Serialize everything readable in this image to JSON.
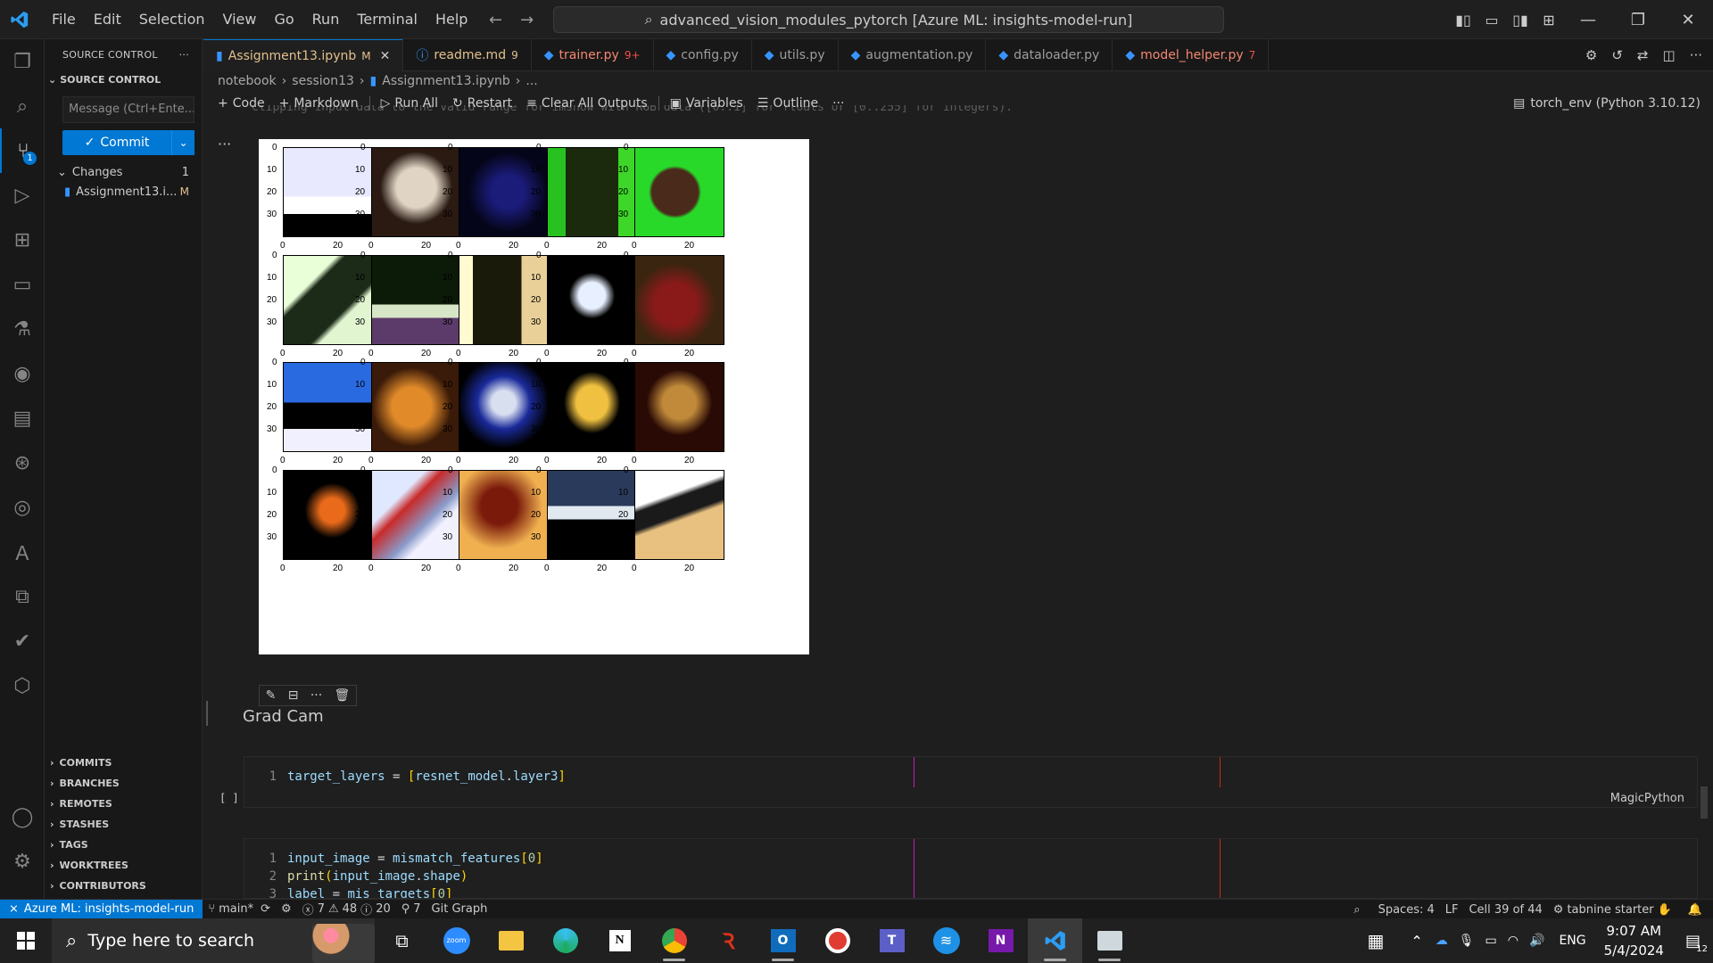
{
  "window": {
    "title": "advanced_vision_modules_pytorch [Azure ML: insights-model-run]"
  },
  "menu": [
    "File",
    "Edit",
    "Selection",
    "View",
    "Go",
    "Run",
    "Terminal",
    "Help"
  ],
  "sidebar": {
    "header": "SOURCE CONTROL",
    "subheader": "SOURCE CONTROL",
    "message_placeholder": "Message (Ctrl+Ente...",
    "commit_label": "Commit",
    "changes_label": "Changes",
    "changes_count": "1",
    "file_name": "Assignment13.i...",
    "file_status": "M",
    "sections": [
      "COMMITS",
      "BRANCHES",
      "REMOTES",
      "STASHES",
      "TAGS",
      "WORKTREES",
      "CONTRIBUTORS"
    ],
    "scm_badge": "1"
  },
  "tabs": [
    {
      "name": "Assignment13.ipynb",
      "decoration": "M",
      "active": true
    },
    {
      "name": "readme.md",
      "decoration": "9"
    },
    {
      "name": "trainer.py",
      "decoration": "9+"
    },
    {
      "name": "config.py",
      "decoration": ""
    },
    {
      "name": "utils.py",
      "decoration": ""
    },
    {
      "name": "augmentation.py",
      "decoration": ""
    },
    {
      "name": "dataloader.py",
      "decoration": ""
    },
    {
      "name": "model_helper.py",
      "decoration": "7"
    }
  ],
  "breadcrumb": [
    "notebook",
    "session13",
    "Assignment13.ipynb",
    "..."
  ],
  "toolbar": {
    "code": "Code",
    "markdown": "Markdown",
    "run_all": "Run All",
    "restart": "Restart",
    "clear": "Clear All Outputs",
    "variables": "Variables",
    "outline": "Outline",
    "more": "···",
    "kernel": "torch_env (Python 3.10.12)"
  },
  "output": {
    "overflow_line": "Clipping input data to the valid range for imshow with RGB data ([0..1] for floats or [0..255] for integers).",
    "x_ticks": [
      "0",
      "20"
    ],
    "y_ticks": [
      "0",
      "10",
      "20",
      "30"
    ]
  },
  "markdown_cell": {
    "text": "Grad Cam"
  },
  "code_cells": [
    {
      "exec": "[ ]",
      "language": "MagicPython",
      "lines": [
        {
          "n": "1",
          "parts": [
            "target_layers",
            " = ",
            "[",
            "resnet_model",
            ".",
            "layer3",
            "]"
          ]
        }
      ]
    },
    {
      "lines": [
        {
          "n": "1",
          "parts": [
            "input_image",
            " = ",
            "mismatch_features",
            "[",
            "0",
            "]"
          ]
        },
        {
          "n": "2",
          "parts": [
            "print",
            "(",
            "input_image",
            ".",
            "shape",
            ")"
          ]
        },
        {
          "n": "3",
          "parts": [
            "label",
            " = ",
            "mis_targets",
            "[",
            "0",
            "]"
          ]
        }
      ]
    }
  ],
  "statusbar": {
    "remote": "Azure ML: insights-model-run",
    "branch": "main*",
    "errors": "7",
    "warnings": "48",
    "infos": "20",
    "ports": "7",
    "git_graph": "Git Graph",
    "spaces": "Spaces: 4",
    "eol": "LF",
    "cell": "Cell 39 of 44",
    "tabnine": "tabnine starter"
  },
  "taskbar": {
    "search_placeholder": "Type here to search",
    "time": "9:07 AM",
    "date": "5/4/2024",
    "lang": "ENG",
    "notif_count": "12"
  }
}
